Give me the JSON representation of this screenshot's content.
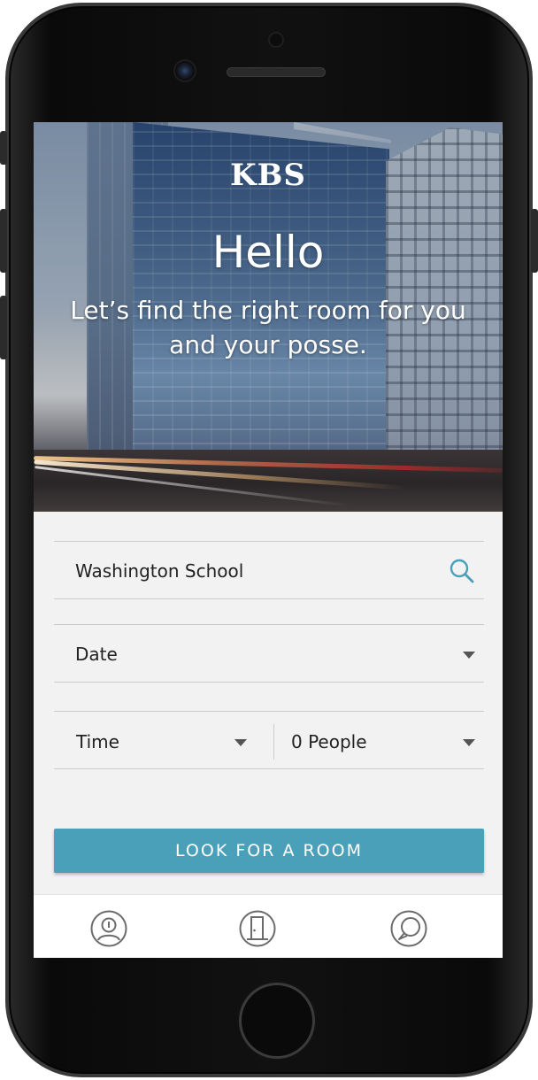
{
  "hero": {
    "logo": "KBS",
    "title": "Hello",
    "subtitle": "Let’s find the right room for you and your posse."
  },
  "form": {
    "location_value": "Washington School",
    "date_label": "Date",
    "time_label": "Time",
    "people_label": "0 People",
    "submit_label": "LOOK FOR A ROOM"
  },
  "tabbar": {
    "items": [
      {
        "icon": "profile-icon"
      },
      {
        "icon": "door-icon"
      },
      {
        "icon": "search-chat-icon"
      }
    ]
  },
  "colors": {
    "accent": "#4a9fb9",
    "background": "#f2f2f2"
  }
}
